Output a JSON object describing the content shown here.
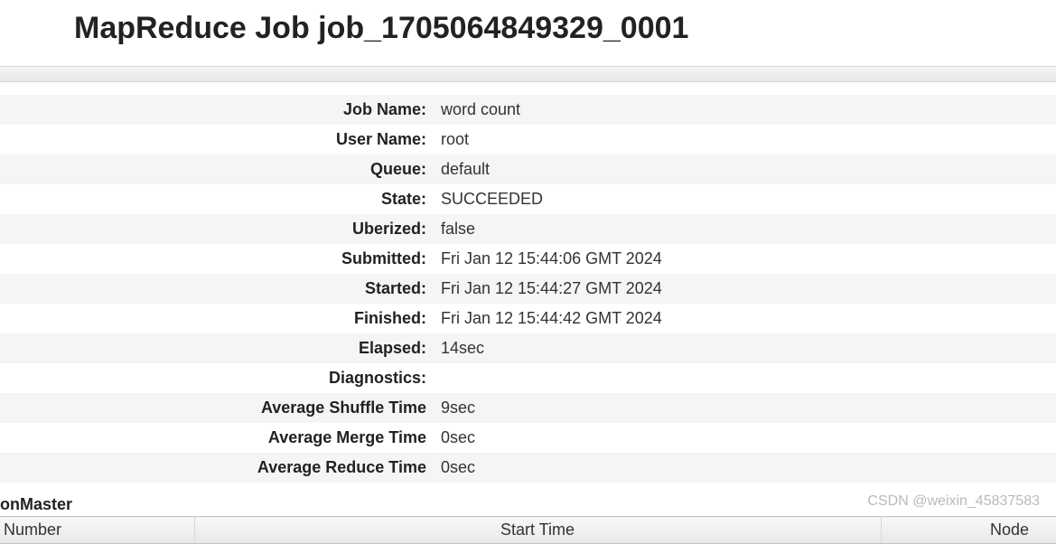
{
  "title": "MapReduce Job job_1705064849329_0001",
  "info_rows": [
    {
      "label": "Job Name:",
      "value": "word count"
    },
    {
      "label": "User Name:",
      "value": "root"
    },
    {
      "label": "Queue:",
      "value": "default"
    },
    {
      "label": "State:",
      "value": "SUCCEEDED"
    },
    {
      "label": "Uberized:",
      "value": "false"
    },
    {
      "label": "Submitted:",
      "value": "Fri Jan 12 15:44:06 GMT 2024"
    },
    {
      "label": "Started:",
      "value": "Fri Jan 12 15:44:27 GMT 2024"
    },
    {
      "label": "Finished:",
      "value": "Fri Jan 12 15:44:42 GMT 2024"
    },
    {
      "label": "Elapsed:",
      "value": "14sec"
    },
    {
      "label": "Diagnostics:",
      "value": ""
    },
    {
      "label": "Average Shuffle Time",
      "value": "9sec"
    },
    {
      "label": "Average Merge Time",
      "value": "0sec"
    },
    {
      "label": "Average Reduce Time",
      "value": "0sec"
    }
  ],
  "section_header": "onMaster",
  "attempts_columns": {
    "number": "Number",
    "start_time": "Start Time",
    "node": "Node"
  },
  "watermark": "CSDN @weixin_45837583"
}
